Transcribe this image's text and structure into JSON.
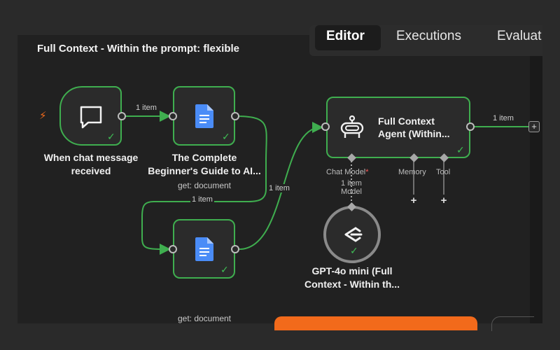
{
  "workflow": {
    "title": "Full Context - Within the prompt: flexible"
  },
  "tabs": [
    {
      "label": "Editor",
      "active": true
    },
    {
      "label": "Executions",
      "active": false
    },
    {
      "label": "Evaluat",
      "active": false
    }
  ],
  "nodes": {
    "trigger": {
      "label_line1": "When chat message",
      "label_line2": "received",
      "icon": "chat-bubble-icon"
    },
    "doc1": {
      "label_line1": "The Complete",
      "label_line2": "Beginner's Guide to AI...",
      "sub": "get: document",
      "icon": "google-docs-icon"
    },
    "doc2": {
      "sub": "get: document",
      "icon": "google-docs-icon"
    },
    "agent": {
      "label_line1": "Full Context",
      "label_line2": "Agent (Within...",
      "icon": "robot-icon"
    },
    "model": {
      "label_line1": "GPT-4o mini (Full",
      "label_line2": "Context - Within th...",
      "icon": "openai-icon"
    }
  },
  "edges": {
    "e1": "1 item",
    "e2": "1 item",
    "e3": "1 item",
    "e4": "1 item",
    "model_edge_line1": "1 item",
    "model_edge_line2": "Model"
  },
  "connectors": {
    "chat_model": "Chat Model",
    "required_mark": "*",
    "memory": "Memory",
    "tool": "Tool"
  },
  "glyphs": {
    "plus": "+",
    "check": "✓",
    "bolt": "⚡"
  },
  "colors": {
    "success": "#3fae4f",
    "accent": "#f26a1b",
    "canvas": "#212121"
  }
}
